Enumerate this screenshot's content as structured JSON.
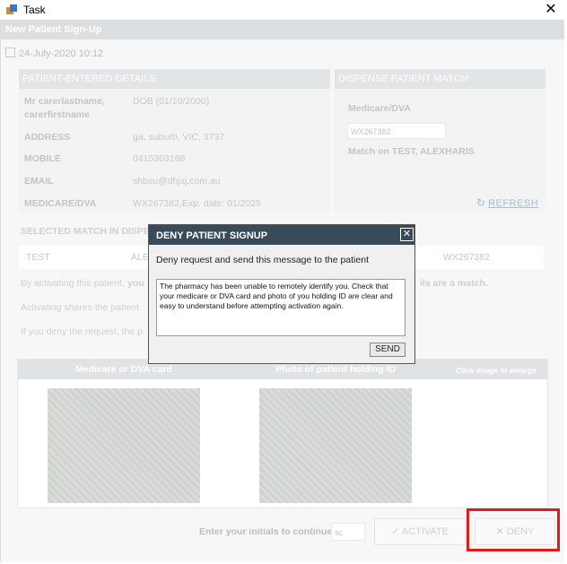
{
  "window": {
    "title": "Task",
    "close_glyph": "✕",
    "app_icon": "app-icon"
  },
  "form": {
    "header": "New Patient Sign-Up",
    "date": "24-July-2020 10:12",
    "sections": {
      "patient_details": "PATIENT-ENTERED DETAILS",
      "dispense_match": "DISPENSE PATIENT MATCH",
      "selected_match": "SELECTED MATCH IN DISPE"
    },
    "patient": {
      "name_line1": "Mr carerlastname,",
      "name_line2": "carerfirstname",
      "dob": "DOB (01/10/2000)",
      "address_label": "ADDRESS",
      "address": "ga, suburb, VIC, 3737",
      "mobile_label": "MOBILE",
      "mobile": "0415303168",
      "email_label": "EMAIL",
      "email": "shbsu@dhjxj.com.au",
      "medicare_label": "MEDICARE/DVA",
      "medicare": "WX267382,Exp. date: 01/2025"
    },
    "dispense": {
      "medicare_label": "Medicare/DVA",
      "medicare_value": "WX267382",
      "match_text": "Match on TEST, ALEXHARIS",
      "refresh": "REFRESH"
    },
    "selected": {
      "name": "TEST",
      "name2": "ALE",
      "medicare": "WX267382"
    },
    "paragraphs": {
      "p1_start": "By activating this patient,",
      "p1_bold": "you",
      "p1_end": "ils are a match.",
      "p2": "Activating shares the patient",
      "p3": "If you deny the request, the p"
    },
    "images": {
      "medicare_card": "Medicare or DVA card",
      "photo_id": "Photo of patient holding ID",
      "hint": "Click image to enlarge"
    },
    "footer": {
      "initials_label": "Enter your initials to continue",
      "initials_value": "sc",
      "activate": "ACTIVATE",
      "deny": "DENY"
    }
  },
  "modal": {
    "title": "DENY PATIENT SIGNUP",
    "close_glyph": "✕",
    "instruction": "Deny request and send this message to the patient",
    "message": "The pharmacy has been unable to remotely identify you. Check that your medicare or DVA card and photo of you holding ID are clear and easy to understand before attempting activation again.",
    "send": "SEND"
  },
  "colors": {
    "modal_header": "#394a5a",
    "deny_highlight": "#e11b1b",
    "refresh_link": "#9ec0d8"
  }
}
